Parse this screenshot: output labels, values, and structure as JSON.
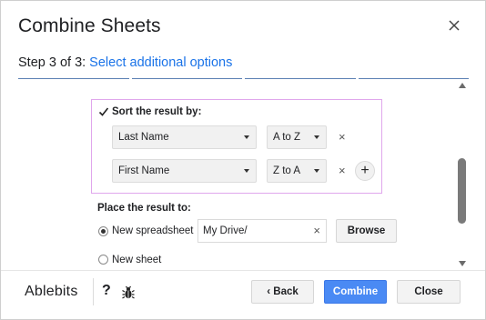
{
  "dialog": {
    "title": "Combine Sheets",
    "step_label": "Step 3 of 3:",
    "step_link": "Select additional options"
  },
  "sort": {
    "label": "Sort the result by:",
    "checked": true,
    "rows": [
      {
        "column": "Last Name",
        "order": "A to Z"
      },
      {
        "column": "First Name",
        "order": "Z to A"
      }
    ],
    "remove_glyph": "×",
    "add_glyph": "+"
  },
  "place": {
    "label": "Place the result to:",
    "options": [
      {
        "label": "New spreadsheet",
        "selected": true
      },
      {
        "label": "New sheet",
        "selected": false
      }
    ],
    "path_value": "My Drive/",
    "clear_glyph": "×",
    "browse_label": "Browse"
  },
  "footer": {
    "brand": "Ablebits",
    "help": "?",
    "back_label": "‹ Back",
    "combine_label": "Combine",
    "close_label": "Close"
  },
  "colors": {
    "accent": "#1a73e8",
    "primary_button": "#4a8af4",
    "highlight_border": "#e0a6ec"
  },
  "icons": {
    "close": "close-icon",
    "checkbox": "checkmark-icon",
    "dropdown": "caret-down-icon",
    "add": "plus-icon",
    "help": "question-icon",
    "bug": "bug-icon"
  }
}
